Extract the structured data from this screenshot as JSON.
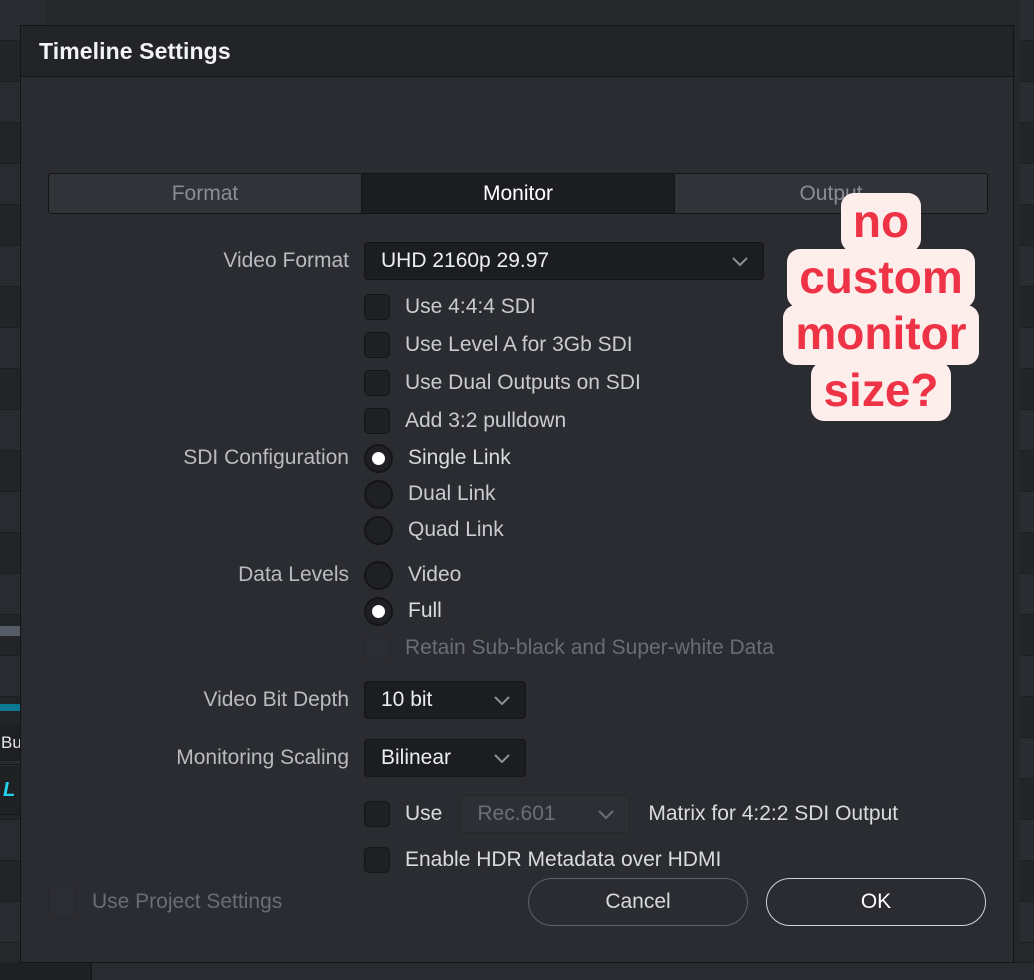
{
  "dialog": {
    "title": "Timeline Settings",
    "tabs": [
      {
        "label": "Format",
        "active": false
      },
      {
        "label": "Monitor",
        "active": true
      },
      {
        "label": "Output",
        "active": false
      }
    ],
    "fields": {
      "video_format": {
        "label": "Video Format",
        "value": "UHD 2160p 29.97"
      },
      "use_444_sdi": {
        "label": "Use 4:4:4 SDI",
        "checked": false
      },
      "use_level_a": {
        "label": "Use Level A for 3Gb SDI",
        "checked": false
      },
      "use_dual_outputs": {
        "label": "Use Dual Outputs on SDI",
        "checked": false
      },
      "add_32_pulldown": {
        "label": "Add 3:2 pulldown",
        "checked": false
      },
      "sdi_configuration": {
        "label": "SDI Configuration",
        "options": [
          "Single Link",
          "Dual Link",
          "Quad Link"
        ],
        "selected": "Single Link"
      },
      "data_levels": {
        "label": "Data Levels",
        "options": [
          "Video",
          "Full"
        ],
        "selected": "Full"
      },
      "retain_subblack": {
        "label": "Retain Sub-black and Super-white Data",
        "checked": false,
        "disabled": true
      },
      "video_bit_depth": {
        "label": "Video Bit Depth",
        "value": "10 bit"
      },
      "monitoring_scaling": {
        "label": "Monitoring Scaling",
        "value": "Bilinear"
      },
      "matrix": {
        "use_label": "Use",
        "value": "Rec.601",
        "suffix_label": "Matrix for 4:2:2 SDI Output",
        "checked": false,
        "select_disabled": true
      },
      "enable_hdr": {
        "label": "Enable HDR Metadata over HDMI",
        "checked": false
      }
    },
    "footer": {
      "use_project_settings": {
        "label": "Use Project Settings",
        "checked": false,
        "disabled": true
      },
      "cancel_label": "Cancel",
      "ok_label": "OK"
    }
  },
  "annotation": {
    "lines": [
      "no",
      "custom",
      "monitor",
      "size?"
    ],
    "text_color": "#ef3347",
    "highlight_color": "#fdeeec"
  },
  "background": {
    "clip_name": "Bu",
    "clip_marker": "L"
  }
}
